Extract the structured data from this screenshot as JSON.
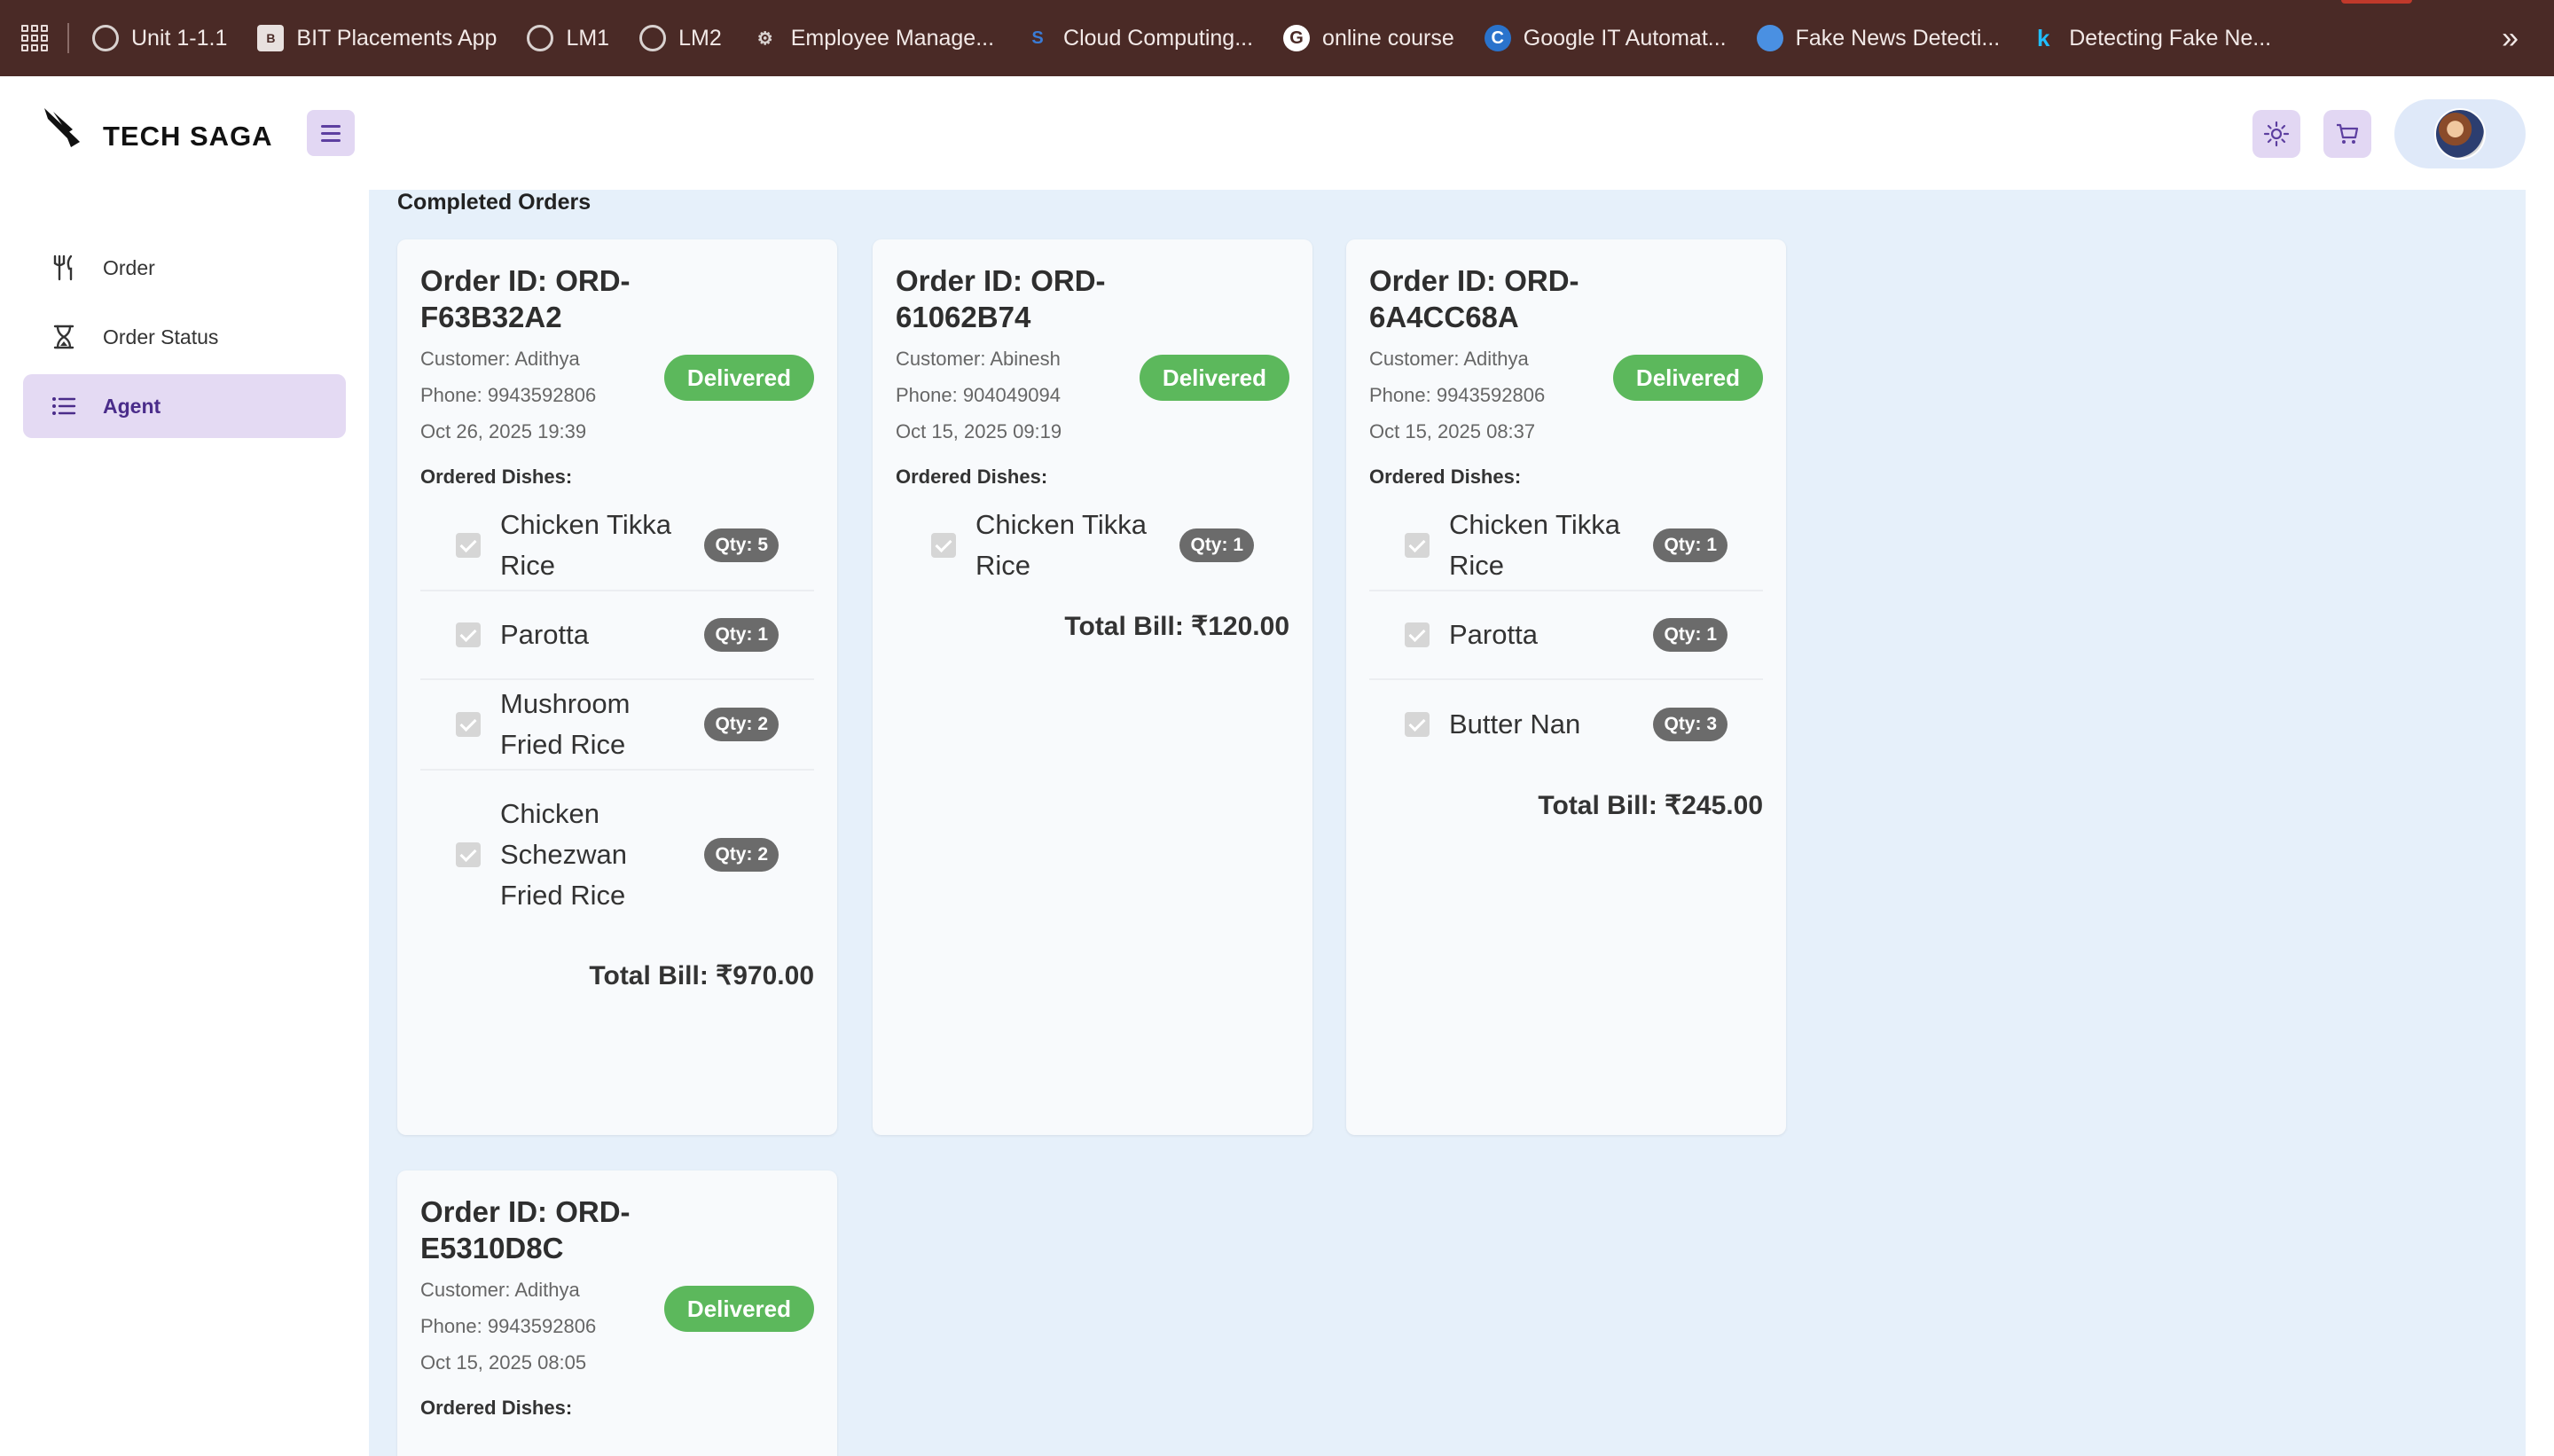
{
  "bookmarks": {
    "items": [
      {
        "label": "Unit 1-1.1",
        "icon": "globe-icon",
        "color": "#d9d2d0"
      },
      {
        "label": "BIT Placements App",
        "icon": "bit-app-icon",
        "color": "#d9d2d0"
      },
      {
        "label": "LM1",
        "icon": "globe-icon",
        "color": "#d9d2d0"
      },
      {
        "label": "LM2",
        "icon": "globe-icon",
        "color": "#d9d2d0"
      },
      {
        "label": "Employee Manage...",
        "icon": "gears-icon",
        "color": "#d9d2d0"
      },
      {
        "label": "Cloud Computing...",
        "icon": "skillrack-icon",
        "color": "#3a7bd5"
      },
      {
        "label": "online course",
        "icon": "google-icon",
        "color": "#ffffff"
      },
      {
        "label": "Google IT Automat...",
        "icon": "coursera-icon",
        "color": "#2a73cc"
      },
      {
        "label": "Fake News Detecti...",
        "icon": "site-icon",
        "color": "#4a90e2"
      },
      {
        "label": "Detecting Fake Ne...",
        "icon": "kaggle-icon",
        "color": "#20beff"
      }
    ]
  },
  "header": {
    "brand": "TECH SAGA"
  },
  "sidebar": {
    "items": [
      {
        "label": "Order",
        "icon": "fork-knife-icon",
        "active": false
      },
      {
        "label": "Order Status",
        "icon": "hourglass-icon",
        "active": false
      },
      {
        "label": "Agent",
        "icon": "list-icon",
        "active": true
      }
    ]
  },
  "main": {
    "section_title": "Completed Orders",
    "orders": [
      {
        "order_id": "Order ID: ORD-F63B32A2",
        "customer": "Customer: Adithya",
        "phone": "Phone: 9943592806",
        "date": "Oct 26, 2025 19:39",
        "status": "Delivered",
        "dishes_label": "Ordered Dishes:",
        "dishes": [
          {
            "name": "Chicken Tikka Rice",
            "qty": "Qty: 5"
          },
          {
            "name": "Parotta",
            "qty": "Qty: 1"
          },
          {
            "name": "Mushroom Fried Rice",
            "qty": "Qty: 2"
          },
          {
            "name": "Chicken Schezwan Fried Rice",
            "qty": "Qty: 2"
          }
        ],
        "total": "Total Bill: ₹970.00"
      },
      {
        "order_id": "Order ID: ORD-61062B74",
        "customer": "Customer: Abinesh",
        "phone": "Phone: 904049094",
        "date": "Oct 15, 2025 09:19",
        "status": "Delivered",
        "dishes_label": "Ordered Dishes:",
        "dishes": [
          {
            "name": "Chicken Tikka Rice",
            "qty": "Qty: 1"
          }
        ],
        "total": "Total Bill: ₹120.00"
      },
      {
        "order_id": "Order ID: ORD-6A4CC68A",
        "customer": "Customer: Adithya",
        "phone": "Phone: 9943592806",
        "date": "Oct 15, 2025 08:37",
        "status": "Delivered",
        "dishes_label": "Ordered Dishes:",
        "dishes": [
          {
            "name": "Chicken Tikka Rice",
            "qty": "Qty: 1"
          },
          {
            "name": "Parotta",
            "qty": "Qty: 1"
          },
          {
            "name": "Butter Nan",
            "qty": "Qty: 3"
          }
        ],
        "total": "Total Bill: ₹245.00"
      },
      {
        "order_id": "Order ID: ORD-E5310D8C",
        "customer": "Customer: Adithya",
        "phone": "Phone: 9943592806",
        "date": "Oct 15, 2025 08:05",
        "status": "Delivered",
        "dishes_label": "Ordered Dishes:",
        "dishes": [],
        "total": ""
      }
    ]
  },
  "colors": {
    "accent": "#e2d7f3",
    "delivered": "#5cb85c",
    "main_bg": "#e6f0fa",
    "bookmarks_bg": "#4a2a26"
  }
}
